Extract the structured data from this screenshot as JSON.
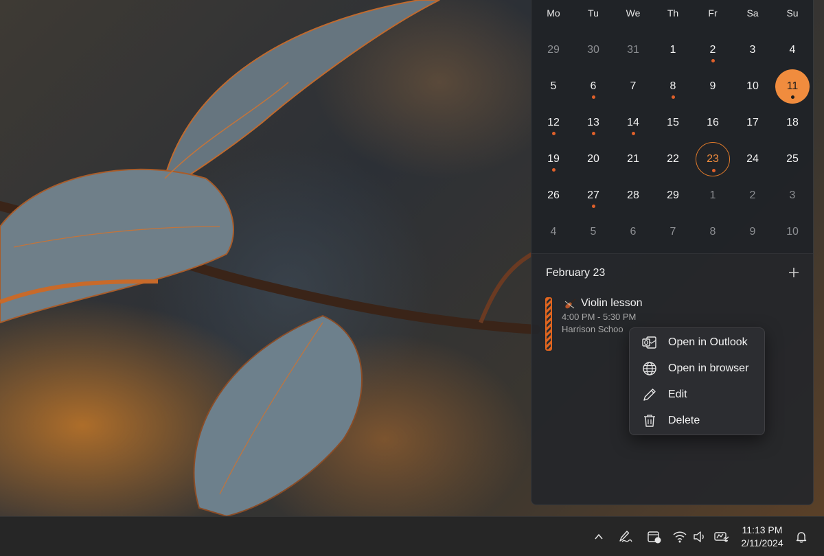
{
  "calendar": {
    "weekdays": [
      "Mo",
      "Tu",
      "We",
      "Th",
      "Fr",
      "Sa",
      "Su"
    ],
    "weeks": [
      [
        {
          "d": "29",
          "muted": true
        },
        {
          "d": "30",
          "muted": true
        },
        {
          "d": "31",
          "muted": true
        },
        {
          "d": "1"
        },
        {
          "d": "2",
          "dot": true
        },
        {
          "d": "3"
        },
        {
          "d": "4"
        }
      ],
      [
        {
          "d": "5"
        },
        {
          "d": "6",
          "dot": true
        },
        {
          "d": "7"
        },
        {
          "d": "8",
          "dot": true
        },
        {
          "d": "9"
        },
        {
          "d": "10"
        },
        {
          "d": "11",
          "today": true,
          "dot": true
        }
      ],
      [
        {
          "d": "12",
          "dot": true
        },
        {
          "d": "13",
          "dot": true
        },
        {
          "d": "14",
          "dot": true
        },
        {
          "d": "15"
        },
        {
          "d": "16"
        },
        {
          "d": "17"
        },
        {
          "d": "18"
        }
      ],
      [
        {
          "d": "19",
          "dot": true
        },
        {
          "d": "20"
        },
        {
          "d": "21"
        },
        {
          "d": "22"
        },
        {
          "d": "23",
          "selected": true,
          "dot": true
        },
        {
          "d": "24"
        },
        {
          "d": "25"
        }
      ],
      [
        {
          "d": "26"
        },
        {
          "d": "27",
          "dot": true
        },
        {
          "d": "28"
        },
        {
          "d": "29"
        },
        {
          "d": "1",
          "muted": true
        },
        {
          "d": "2",
          "muted": true
        },
        {
          "d": "3",
          "muted": true
        }
      ],
      [
        {
          "d": "4",
          "muted": true
        },
        {
          "d": "5",
          "muted": true
        },
        {
          "d": "6",
          "muted": true
        },
        {
          "d": "7",
          "muted": true
        },
        {
          "d": "8",
          "muted": true
        },
        {
          "d": "9",
          "muted": true
        },
        {
          "d": "10",
          "muted": true
        }
      ]
    ]
  },
  "agenda": {
    "title": "February 23",
    "add_icon": "plus-icon",
    "event": {
      "title": "Violin lesson",
      "time": "4:00 PM - 5:30 PM",
      "location": "Harrison Schoo",
      "color": "#e0651f",
      "icon": "violin-icon"
    }
  },
  "context_menu": [
    {
      "label": "Open in Outlook",
      "icon": "outlook-icon"
    },
    {
      "label": "Open in browser",
      "icon": "globe-icon"
    },
    {
      "label": "Edit",
      "icon": "pencil-icon"
    },
    {
      "label": "Delete",
      "icon": "trash-icon"
    }
  ],
  "taskbar": {
    "time": "11:13 PM",
    "date": "2/11/2024",
    "icons": [
      "chevron-up-icon",
      "pen-icon",
      "meet-now-icon",
      "wifi-icon",
      "volume-icon",
      "battery-icon",
      "notification-bell-icon"
    ]
  },
  "colors": {
    "accent": "#f08c3e",
    "event_dot": "#e0602a"
  }
}
